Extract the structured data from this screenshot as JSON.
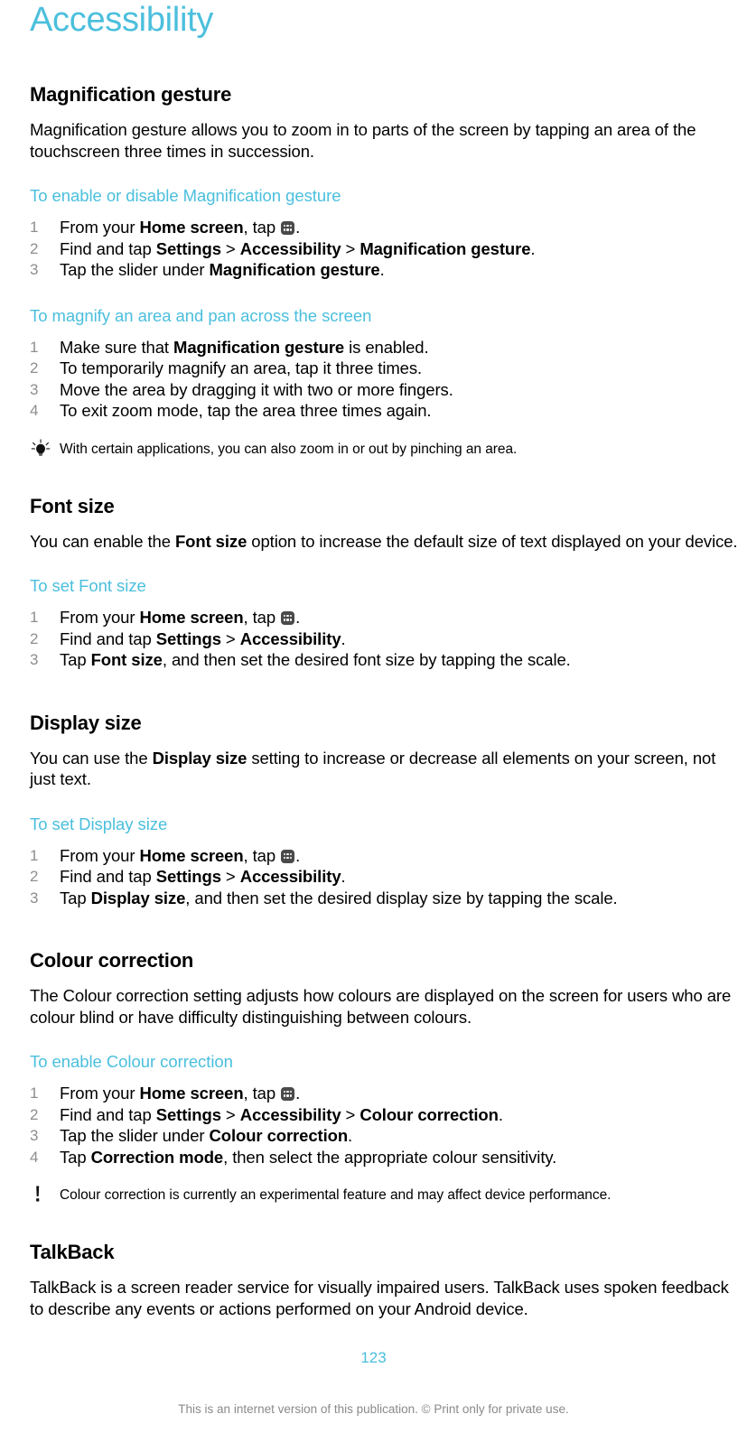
{
  "document": {
    "chapter_title": "Accessibility",
    "page_number": "123",
    "footer_note": "This is an internet version of this publication. © Print only for private use.",
    "accent_color": "#4BBFDD",
    "step_number_color": "#8e8e8e",
    "footer_color": "#8a8a8a"
  },
  "sections": {
    "magnification": {
      "heading": "Magnification gesture",
      "intro": "Magnification gesture allows you to zoom in to parts of the screen by tapping an area of the touchscreen three times in succession.",
      "proc1": {
        "heading": "To enable or disable Magnification gesture",
        "steps": [
          {
            "pre": "From your ",
            "b1": "Home screen",
            "mid": ", tap ",
            "icon": "app-drawer-icon",
            "post": "."
          },
          {
            "pre": "Find and tap ",
            "b1": "Settings",
            "sep1": " > ",
            "b2": "Accessibility",
            "sep2": " > ",
            "b3": "Magnification gesture",
            "post": "."
          },
          {
            "pre": "Tap the slider under ",
            "b1": "Magnification gesture",
            "post": "."
          }
        ]
      },
      "proc2": {
        "heading": "To magnify an area and pan across the screen",
        "steps": [
          {
            "pre": "Make sure that ",
            "b1": "Magnification gesture",
            "post": " is enabled."
          },
          {
            "pre": "To temporarily magnify an area, tap it three times."
          },
          {
            "pre": "Move the area by dragging it with two or more fingers."
          },
          {
            "pre": "To exit zoom mode, tap the area three times again."
          }
        ]
      },
      "tip": {
        "icon": "lightbulb-tip-icon",
        "text": "With certain applications, you can also zoom in or out by pinching an area."
      }
    },
    "font_size": {
      "heading": "Font size",
      "intro_pre": "You can enable the ",
      "intro_b": "Font size",
      "intro_post": " option to increase the default size of text displayed on your device.",
      "proc": {
        "heading": "To set Font size",
        "steps": [
          {
            "pre": "From your ",
            "b1": "Home screen",
            "mid": ", tap ",
            "icon": "app-drawer-icon",
            "post": "."
          },
          {
            "pre": "Find and tap ",
            "b1": "Settings",
            "sep1": " > ",
            "b2": "Accessibility",
            "post": "."
          },
          {
            "pre": "Tap ",
            "b1": "Font size",
            "post": ", and then set the desired font size by tapping the scale."
          }
        ]
      }
    },
    "display_size": {
      "heading": "Display size",
      "intro_pre": "You can use the ",
      "intro_b": "Display size",
      "intro_post": " setting to increase or decrease all elements on your screen, not just text.",
      "proc": {
        "heading": "To set Display size",
        "steps": [
          {
            "pre": "From your ",
            "b1": "Home screen",
            "mid": ", tap ",
            "icon": "app-drawer-icon",
            "post": "."
          },
          {
            "pre": "Find and tap ",
            "b1": "Settings",
            "sep1": " > ",
            "b2": "Accessibility",
            "post": "."
          },
          {
            "pre": "Tap ",
            "b1": "Display size",
            "post": ", and then set the desired display size by tapping the scale."
          }
        ]
      }
    },
    "colour_correction": {
      "heading": "Colour correction",
      "intro": "The Colour correction setting adjusts how colours are displayed on the screen for users who are colour blind or have difficulty distinguishing between colours.",
      "proc": {
        "heading": "To enable Colour correction",
        "steps": [
          {
            "pre": "From your ",
            "b1": "Home screen",
            "mid": ", tap ",
            "icon": "app-drawer-icon",
            "post": "."
          },
          {
            "pre": "Find and tap ",
            "b1": "Settings",
            "sep1": " > ",
            "b2": "Accessibility",
            "sep2": " > ",
            "b3": "Colour correction",
            "post": "."
          },
          {
            "pre": "Tap the slider under ",
            "b1": "Colour correction",
            "post": "."
          },
          {
            "pre": "Tap ",
            "b1": "Correction mode",
            "post": ", then select the appropriate colour sensitivity."
          }
        ]
      },
      "warning": {
        "icon": "exclamation-warning-icon",
        "text": "Colour correction is currently an experimental feature and may affect device performance."
      }
    },
    "talkback": {
      "heading": "TalkBack",
      "intro": "TalkBack is a screen reader service for visually impaired users. TalkBack uses spoken feedback to describe any events or actions performed on your Android device."
    }
  }
}
